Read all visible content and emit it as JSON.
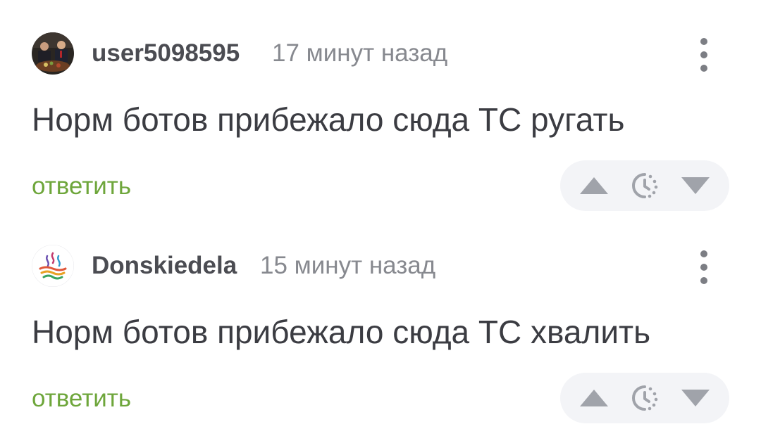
{
  "comments": [
    {
      "username": "user5098595",
      "timestamp": "17 минут назад",
      "text": "Норм ботов прибежало сюда ТС ругать",
      "reply_label": "ответить",
      "avatar": "photo-avatar"
    },
    {
      "username": "Donskiedela",
      "timestamp": "15 минут назад",
      "text": "Норм ботов прибежало сюда ТС хвалить",
      "reply_label": "ответить",
      "avatar": "logo-avatar"
    }
  ],
  "icons": {
    "menu": "more-vertical-icon",
    "upvote": "triangle-up-icon",
    "rating": "clock-icon",
    "downvote": "triangle-down-icon"
  },
  "colors": {
    "username": "#4b4c52",
    "timestamp": "#87898f",
    "text": "#3b3c42",
    "reply": "#6ea63b",
    "icon": "#a0a3aa",
    "pill_bg": "#f3f4f7"
  }
}
